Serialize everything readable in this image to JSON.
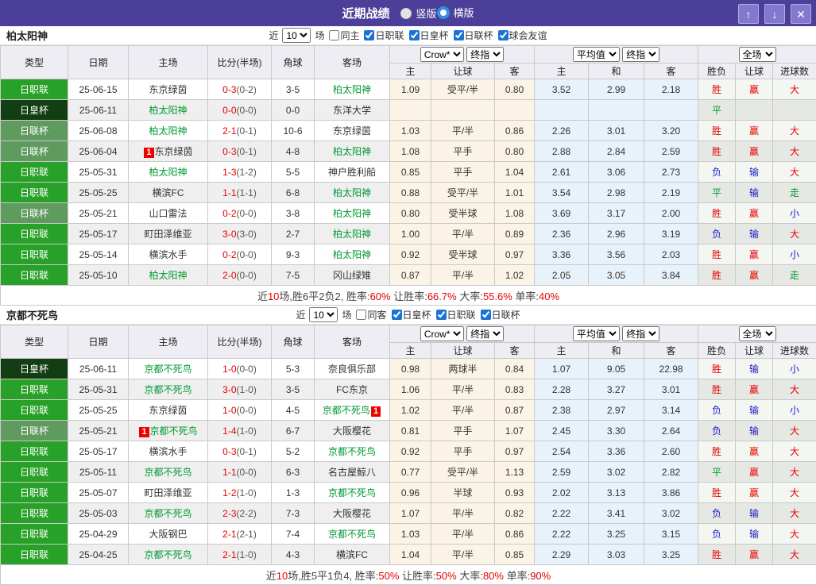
{
  "title_bar": {
    "title": "近期战绩",
    "layout_options": [
      {
        "label": "竖版",
        "selected": false
      },
      {
        "label": "横版",
        "selected": true
      }
    ],
    "window_buttons": {
      "up": "↑",
      "down": "↓",
      "close": "✕"
    }
  },
  "colors": {
    "titlebar_bg": "#4c3f99",
    "type_bg": {
      "日职联": "#27a127",
      "日皇杯": "#133d13",
      "日联杯": "#5f9a5f"
    },
    "result_text": {
      "胜": "#e60000",
      "负": "#1a1ac8",
      "平": "#009933",
      "赢": "#e60000",
      "输": "#1a1ac8",
      "大": "#e60000",
      "小": "#1a1ac8",
      "走": "#009933"
    },
    "team_active": "#009933",
    "score_red": "#e60000"
  },
  "table_header": {
    "main_cols": [
      "类型",
      "日期",
      "主场",
      "比分(半场)",
      "角球",
      "客场"
    ],
    "group1_selects": [
      "Crow*",
      "终指"
    ],
    "group2_selects": [
      "平均值",
      "终指"
    ],
    "group3_selects": [
      "全场"
    ],
    "sub_cols": [
      "主",
      "让球",
      "客",
      "主",
      "和",
      "客",
      "胜负",
      "让球",
      "进球数"
    ]
  },
  "sections": [
    {
      "team": "柏太阳神",
      "filters": {
        "prefix": "近",
        "count": "10",
        "suffix": "场",
        "same_option": "同主",
        "same_checked": false,
        "leagues": [
          "日职联",
          "日皇杯",
          "日联杯",
          "球会友谊"
        ]
      },
      "rows": [
        {
          "type": "日职联",
          "date": "25-06-15",
          "home": "东京绿茵",
          "home_active": false,
          "home_badge": "",
          "score": "0-3",
          "half": "(0-2)",
          "corner": "3-5",
          "away": "柏太阳神",
          "away_active": true,
          "away_badge": "",
          "odds": [
            "1.09",
            "受平/半",
            "0.80"
          ],
          "avg": [
            "3.52",
            "2.99",
            "2.18"
          ],
          "results": [
            "胜",
            "赢",
            "大"
          ]
        },
        {
          "type": "日皇杯",
          "date": "25-06-11",
          "home": "柏太阳神",
          "home_active": true,
          "home_badge": "",
          "score": "0-0",
          "half": "(0-0)",
          "corner": "0-0",
          "away": "东洋大学",
          "away_active": false,
          "away_badge": "",
          "odds": [
            "",
            "",
            ""
          ],
          "avg": [
            "",
            "",
            ""
          ],
          "results": [
            "平",
            "",
            ""
          ]
        },
        {
          "type": "日联杯",
          "date": "25-06-08",
          "home": "柏太阳神",
          "home_active": true,
          "home_badge": "",
          "score": "2-1",
          "half": "(0-1)",
          "corner": "10-6",
          "away": "东京绿茵",
          "away_active": false,
          "away_badge": "",
          "odds": [
            "1.03",
            "平/半",
            "0.86"
          ],
          "avg": [
            "2.26",
            "3.01",
            "3.20"
          ],
          "results": [
            "胜",
            "赢",
            "大"
          ]
        },
        {
          "type": "日联杯",
          "date": "25-06-04",
          "home": "东京绿茵",
          "home_active": false,
          "home_badge": "1",
          "score": "0-3",
          "half": "(0-1)",
          "corner": "4-8",
          "away": "柏太阳神",
          "away_active": true,
          "away_badge": "",
          "odds": [
            "1.08",
            "平手",
            "0.80"
          ],
          "avg": [
            "2.88",
            "2.84",
            "2.59"
          ],
          "results": [
            "胜",
            "赢",
            "大"
          ]
        },
        {
          "type": "日职联",
          "date": "25-05-31",
          "home": "柏太阳神",
          "home_active": true,
          "home_badge": "",
          "score": "1-3",
          "half": "(1-2)",
          "corner": "5-5",
          "away": "神户胜利船",
          "away_active": false,
          "away_badge": "",
          "odds": [
            "0.85",
            "平手",
            "1.04"
          ],
          "avg": [
            "2.61",
            "3.06",
            "2.73"
          ],
          "results": [
            "负",
            "输",
            "大"
          ]
        },
        {
          "type": "日职联",
          "date": "25-05-25",
          "home": "横滨FC",
          "home_active": false,
          "home_badge": "",
          "score": "1-1",
          "half": "(1-1)",
          "corner": "6-8",
          "away": "柏太阳神",
          "away_active": true,
          "away_badge": "",
          "odds": [
            "0.88",
            "受平/半",
            "1.01"
          ],
          "avg": [
            "3.54",
            "2.98",
            "2.19"
          ],
          "results": [
            "平",
            "输",
            "走"
          ]
        },
        {
          "type": "日联杯",
          "date": "25-05-21",
          "home": "山口雷法",
          "home_active": false,
          "home_badge": "",
          "score": "0-2",
          "half": "(0-0)",
          "corner": "3-8",
          "away": "柏太阳神",
          "away_active": true,
          "away_badge": "",
          "odds": [
            "0.80",
            "受半球",
            "1.08"
          ],
          "avg": [
            "3.69",
            "3.17",
            "2.00"
          ],
          "results": [
            "胜",
            "赢",
            "小"
          ]
        },
        {
          "type": "日职联",
          "date": "25-05-17",
          "home": "町田泽维亚",
          "home_active": false,
          "home_badge": "",
          "score": "3-0",
          "half": "(3-0)",
          "corner": "2-7",
          "away": "柏太阳神",
          "away_active": true,
          "away_badge": "",
          "odds": [
            "1.00",
            "平/半",
            "0.89"
          ],
          "avg": [
            "2.36",
            "2.96",
            "3.19"
          ],
          "results": [
            "负",
            "输",
            "大"
          ]
        },
        {
          "type": "日职联",
          "date": "25-05-14",
          "home": "横滨水手",
          "home_active": false,
          "home_badge": "",
          "score": "0-2",
          "half": "(0-0)",
          "corner": "9-3",
          "away": "柏太阳神",
          "away_active": true,
          "away_badge": "",
          "odds": [
            "0.92",
            "受半球",
            "0.97"
          ],
          "avg": [
            "3.36",
            "3.56",
            "2.03"
          ],
          "results": [
            "胜",
            "赢",
            "小"
          ]
        },
        {
          "type": "日职联",
          "date": "25-05-10",
          "home": "柏太阳神",
          "home_active": true,
          "home_badge": "",
          "score": "2-0",
          "half": "(0-0)",
          "corner": "7-5",
          "away": "冈山绿雉",
          "away_active": false,
          "away_badge": "",
          "odds": [
            "0.87",
            "平/半",
            "1.02"
          ],
          "avg": [
            "2.05",
            "3.05",
            "3.84"
          ],
          "results": [
            "胜",
            "赢",
            "走"
          ]
        }
      ],
      "summary": [
        [
          "近",
          0
        ],
        [
          "10",
          1
        ],
        [
          "场,胜6平2负2, 胜率:",
          0
        ],
        [
          "60%",
          1
        ],
        [
          " 让胜率:",
          0
        ],
        [
          "66.7%",
          1
        ],
        [
          " 大率:",
          0
        ],
        [
          "55.6%",
          1
        ],
        [
          " 单率:",
          0
        ],
        [
          "40%",
          1
        ]
      ]
    },
    {
      "team": "京都不死鸟",
      "filters": {
        "prefix": "近",
        "count": "10",
        "suffix": "场",
        "same_option": "同客",
        "same_checked": false,
        "leagues": [
          "日皇杯",
          "日职联",
          "日联杯"
        ]
      },
      "rows": [
        {
          "type": "日皇杯",
          "date": "25-06-11",
          "home": "京都不死鸟",
          "home_active": true,
          "home_badge": "",
          "score": "1-0",
          "half": "(0-0)",
          "corner": "5-3",
          "away": "奈良俱乐部",
          "away_active": false,
          "away_badge": "",
          "odds": [
            "0.98",
            "两球半",
            "0.84"
          ],
          "avg": [
            "1.07",
            "9.05",
            "22.98"
          ],
          "results": [
            "胜",
            "输",
            "小"
          ]
        },
        {
          "type": "日职联",
          "date": "25-05-31",
          "home": "京都不死鸟",
          "home_active": true,
          "home_badge": "",
          "score": "3-0",
          "half": "(1-0)",
          "corner": "3-5",
          "away": "FC东京",
          "away_active": false,
          "away_badge": "",
          "odds": [
            "1.06",
            "平/半",
            "0.83"
          ],
          "avg": [
            "2.28",
            "3.27",
            "3.01"
          ],
          "results": [
            "胜",
            "赢",
            "大"
          ]
        },
        {
          "type": "日职联",
          "date": "25-05-25",
          "home": "东京绿茵",
          "home_active": false,
          "home_badge": "",
          "score": "1-0",
          "half": "(0-0)",
          "corner": "4-5",
          "away": "京都不死鸟",
          "away_active": true,
          "away_badge": "1",
          "odds": [
            "1.02",
            "平/半",
            "0.87"
          ],
          "avg": [
            "2.38",
            "2.97",
            "3.14"
          ],
          "results": [
            "负",
            "输",
            "小"
          ]
        },
        {
          "type": "日联杯",
          "date": "25-05-21",
          "home": "京都不死鸟",
          "home_active": true,
          "home_badge": "1",
          "score": "1-4",
          "half": "(1-0)",
          "corner": "6-7",
          "away": "大阪樱花",
          "away_active": false,
          "away_badge": "",
          "odds": [
            "0.81",
            "平手",
            "1.07"
          ],
          "avg": [
            "2.45",
            "3.30",
            "2.64"
          ],
          "results": [
            "负",
            "输",
            "大"
          ]
        },
        {
          "type": "日职联",
          "date": "25-05-17",
          "home": "横滨水手",
          "home_active": false,
          "home_badge": "",
          "score": "0-3",
          "half": "(0-1)",
          "corner": "5-2",
          "away": "京都不死鸟",
          "away_active": true,
          "away_badge": "",
          "odds": [
            "0.92",
            "平手",
            "0.97"
          ],
          "avg": [
            "2.54",
            "3.36",
            "2.60"
          ],
          "results": [
            "胜",
            "赢",
            "大"
          ]
        },
        {
          "type": "日职联",
          "date": "25-05-11",
          "home": "京都不死鸟",
          "home_active": true,
          "home_badge": "",
          "score": "1-1",
          "half": "(0-0)",
          "corner": "6-3",
          "away": "名古屋鲸八",
          "away_active": false,
          "away_badge": "",
          "odds": [
            "0.77",
            "受平/半",
            "1.13"
          ],
          "avg": [
            "2.59",
            "3.02",
            "2.82"
          ],
          "results": [
            "平",
            "赢",
            "大"
          ]
        },
        {
          "type": "日职联",
          "date": "25-05-07",
          "home": "町田泽维亚",
          "home_active": false,
          "home_badge": "",
          "score": "1-2",
          "half": "(1-0)",
          "corner": "1-3",
          "away": "京都不死鸟",
          "away_active": true,
          "away_badge": "",
          "odds": [
            "0.96",
            "半球",
            "0.93"
          ],
          "avg": [
            "2.02",
            "3.13",
            "3.86"
          ],
          "results": [
            "胜",
            "赢",
            "大"
          ]
        },
        {
          "type": "日职联",
          "date": "25-05-03",
          "home": "京都不死鸟",
          "home_active": true,
          "home_badge": "",
          "score": "2-3",
          "half": "(2-2)",
          "corner": "7-3",
          "away": "大阪樱花",
          "away_active": false,
          "away_badge": "",
          "odds": [
            "1.07",
            "平/半",
            "0.82"
          ],
          "avg": [
            "2.22",
            "3.41",
            "3.02"
          ],
          "results": [
            "负",
            "输",
            "大"
          ]
        },
        {
          "type": "日职联",
          "date": "25-04-29",
          "home": "大阪钢巴",
          "home_active": false,
          "home_badge": "",
          "score": "2-1",
          "half": "(2-1)",
          "corner": "7-4",
          "away": "京都不死鸟",
          "away_active": true,
          "away_badge": "",
          "odds": [
            "1.03",
            "平/半",
            "0.86"
          ],
          "avg": [
            "2.22",
            "3.25",
            "3.15"
          ],
          "results": [
            "负",
            "输",
            "大"
          ]
        },
        {
          "type": "日职联",
          "date": "25-04-25",
          "home": "京都不死鸟",
          "home_active": true,
          "home_badge": "",
          "score": "2-1",
          "half": "(1-0)",
          "corner": "4-3",
          "away": "横滨FC",
          "away_active": false,
          "away_badge": "",
          "odds": [
            "1.04",
            "平/半",
            "0.85"
          ],
          "avg": [
            "2.29",
            "3.03",
            "3.25"
          ],
          "results": [
            "胜",
            "赢",
            "大"
          ]
        }
      ],
      "summary": [
        [
          "近",
          0
        ],
        [
          "10",
          1
        ],
        [
          "场,胜5平1负4, 胜率:",
          0
        ],
        [
          "50%",
          1
        ],
        [
          " 让胜率:",
          0
        ],
        [
          "50%",
          1
        ],
        [
          " 大率:",
          0
        ],
        [
          "80%",
          1
        ],
        [
          " 单率:",
          0
        ],
        [
          "90%",
          1
        ]
      ]
    }
  ]
}
